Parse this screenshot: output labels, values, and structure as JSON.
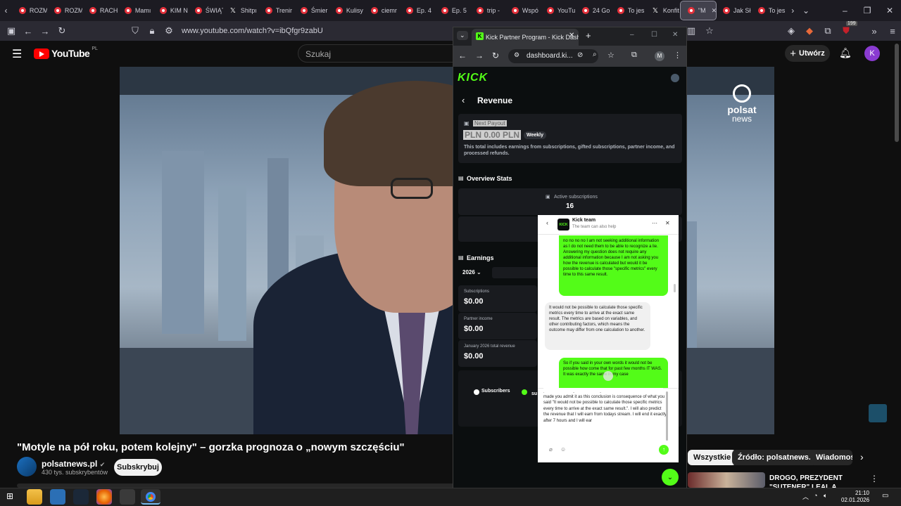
{
  "firefox": {
    "tabs": [
      "ROZM",
      "ROZM",
      "RACH",
      "Mamı",
      "KIM N",
      "ŚWIĄT",
      "Shitpı",
      "Trenir",
      "Śmier",
      "Kulisy",
      "ciemr",
      "Ep. 4",
      "Ep. 5",
      "trip -",
      "Wspó",
      "YouTu",
      "24 Go",
      "To jes",
      "Konfit",
      "\"M",
      "Jak Sł",
      "To jes"
    ],
    "url": "www.youtube.com/watch?v=ibQfgr9zabU",
    "badge_count": "199"
  },
  "youtube": {
    "logo_text": "YouTube",
    "logo_region": "PL",
    "search_placeholder": "Szukaj",
    "create_label": "Utwórz",
    "avatar_letter": "K",
    "video_title": "\"Motyle na pół roku, potem kolejny\" – gorzka prognoza o „nowym szczęściu\"",
    "channel_name": "polsatnews.pl",
    "channel_subs": "430 tys. subskrybentów",
    "subscribe_label": "Subskrybuj",
    "watermark_line1": "polsat",
    "watermark_line2": "news",
    "chips": [
      "Wszystkie",
      "Źródło: polsatnews.pl",
      "Wiadomośc"
    ],
    "recommended_title": "DROGO, PREZYDENT \"SUTENER\" LEAL A UKRAIŃCÓ"
  },
  "chrome": {
    "tab_title": "Kick Partner Program - Kick Dash",
    "url": "dashboard.ki...",
    "profile_letter": "M"
  },
  "kick": {
    "logo": "KICK",
    "page_title": "Revenue",
    "next_payout_label": "Next Payout",
    "next_payout_amount": "PLN 0.00 PLN",
    "payout_frequency": "Weekly",
    "payout_description": "This total includes earnings from subscriptions, gifted subscriptions, partner income, and processed refunds.",
    "overview_title": "Overview Stats",
    "active_subs_label": "Active subscriptions",
    "active_subs_value": "16",
    "earnings_title": "Earnings",
    "year": "2026",
    "earnings": [
      {
        "label": "Subscriptions",
        "value": "$0.00"
      },
      {
        "label": "Partner income",
        "value": "$0.00"
      },
      {
        "label": "January 2026 total revenue",
        "value": "$0.00"
      }
    ],
    "legend_subscribers": "Subscribers",
    "legend_second": "su"
  },
  "chat": {
    "team_name": "Kick team",
    "team_subtitle": "The team can also help",
    "msg_user_1": "no no no no I am not seeking additional information as I do not need them to be able to recognize a lie. Answering my question does not require any additional information because I am not asking you how the revenue is calculated but would it be possible to calculate those \"specific metrics\" every time to this same result.",
    "msg_bot_1": "It would not be possible to calculate those specific metrics every time to arrive at the exact same result. The metrics are based on variables, and other contributing factors, which means the outcome may differ from one calculation to another.",
    "msg_user_2": "So if you said in your own words it would not be possible how come that for past few months IT WAS. It was exactly the same in my case",
    "compose_text": "prove. Score any doubt already that account is limited. I also made you admit it as this conclusion is consequence of what you said \"It would not be possible to calculate those specific metrics every time to arrive at the exact same result.\". I will also predict the revenue that I will earn from todays stream. I will end it exactly after 7 hours and I will ear"
  },
  "taskbar": {
    "time": "21:10",
    "date": "02.01.2026"
  }
}
